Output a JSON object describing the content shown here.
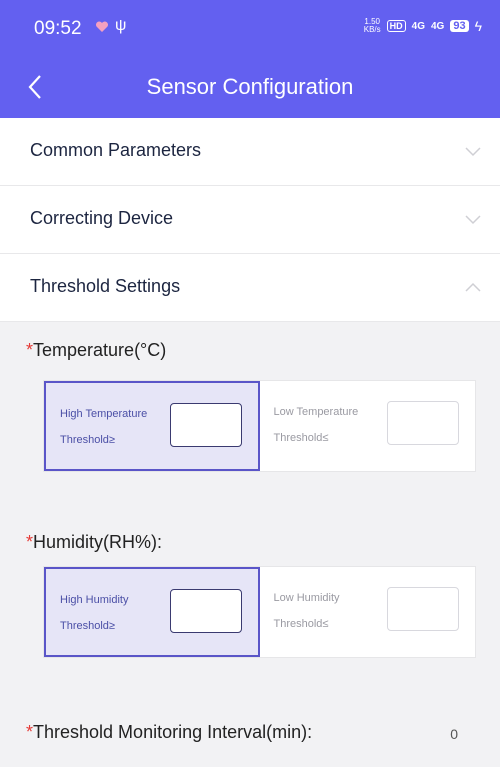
{
  "status_bar": {
    "time": "09:52",
    "net_speed_value": "1.50",
    "net_speed_unit": "KB/s",
    "hd_badge": "HD",
    "signal_1": "4G",
    "signal_2": "4G",
    "battery": "93",
    "icons": [
      "heart-icon",
      "usb-icon",
      "charging-bolt-icon"
    ]
  },
  "header": {
    "title": "Sensor Configuration",
    "back_icon": "chevron-left-icon"
  },
  "sections": [
    {
      "label": "Common Parameters",
      "expanded": false
    },
    {
      "label": "Correcting Device",
      "expanded": false
    },
    {
      "label": "Threshold Settings",
      "expanded": true
    }
  ],
  "threshold": {
    "temperature": {
      "label": "Temperature(°C)",
      "required_mark": "*",
      "high_label_1": "High Temperature",
      "high_label_2": "Threshold≥",
      "high_value": "",
      "low_label_1": "Low Temperature",
      "low_label_2": "Threshold≤",
      "low_value": ""
    },
    "humidity": {
      "label": "Humidity(RH%):",
      "required_mark": "*",
      "high_label_1": "High Humidity",
      "high_label_2": "Threshold≥",
      "high_value": "",
      "low_label_1": "Low Humidity",
      "low_label_2": "Threshold≤",
      "low_value": ""
    },
    "interval": {
      "label": "Threshold Monitoring Interval(min):",
      "required_mark": "*",
      "value": "0"
    }
  },
  "colors": {
    "accent": "#6360f0",
    "active_cell": "#e6e5f7",
    "active_border": "#5a55c8",
    "required": "#e53935"
  }
}
